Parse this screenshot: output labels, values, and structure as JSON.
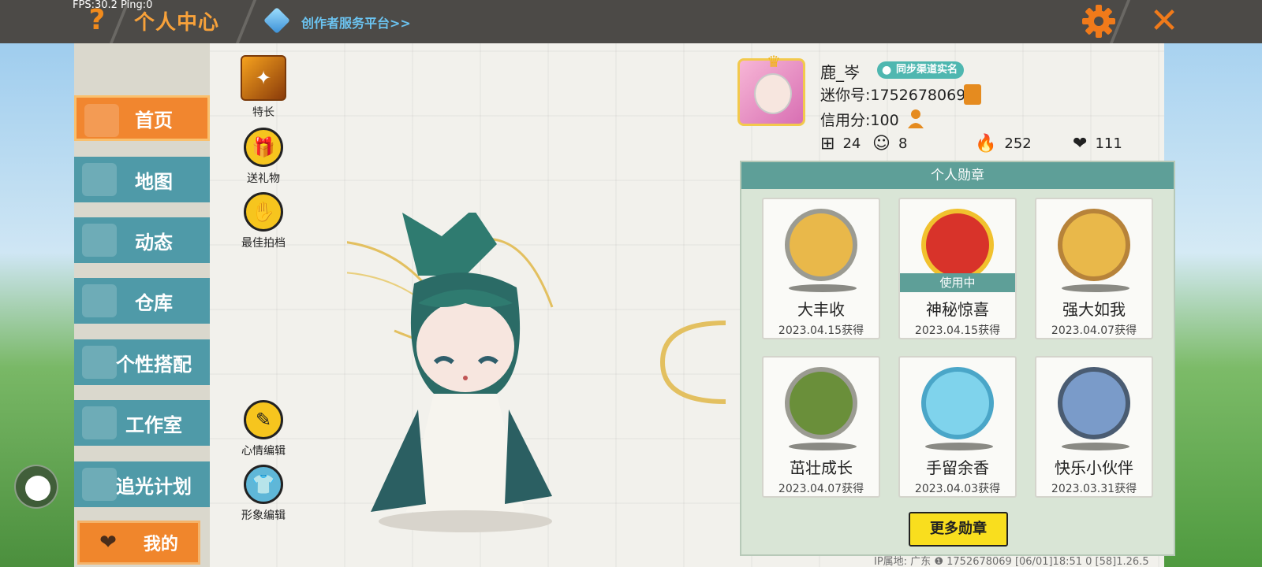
{
  "overlay": {
    "fps": "FPS:30.2",
    "ping": "Ping:0"
  },
  "topbar": {
    "help_icon": "question-icon",
    "title": "个人中心",
    "creator_link": "创作者服务平台>>",
    "settings_icon": "gear-icon",
    "close_icon": "close-icon"
  },
  "sidebar": {
    "items": [
      {
        "label": "首页",
        "active": true
      },
      {
        "label": "地图"
      },
      {
        "label": "动态"
      },
      {
        "label": "仓库"
      },
      {
        "label": "个性搭配"
      },
      {
        "label": "工作室"
      },
      {
        "label": "追光计划"
      }
    ],
    "mine": "我的"
  },
  "tools": {
    "skill": "特长",
    "gift": "送礼物",
    "partner": "最佳拍档",
    "mood": "心情编辑",
    "look": "形象编辑"
  },
  "profile": {
    "name": "鹿_岑",
    "verify": "同步渠道实名",
    "mini_id": "迷你号:1752678069",
    "credit": "信用分:100",
    "stats": {
      "add": "24",
      "fans": "8",
      "hot": "252",
      "likes": "111"
    }
  },
  "badges": {
    "title": "个人勋章",
    "in_use_label": "使用中",
    "items": [
      {
        "name": "大丰收",
        "date": "2023.04.15获得",
        "in_use": false
      },
      {
        "name": "神秘惊喜",
        "date": "2023.04.15获得",
        "in_use": true
      },
      {
        "name": "强大如我",
        "date": "2023.04.07获得",
        "in_use": false
      },
      {
        "name": "茁壮成长",
        "date": "2023.04.07获得",
        "in_use": false
      },
      {
        "name": "手留余香",
        "date": "2023.04.03获得",
        "in_use": false
      },
      {
        "name": "快乐小伙伴",
        "date": "2023.03.31获得",
        "in_use": false
      }
    ],
    "more": "更多勋章"
  },
  "footer": {
    "ip_info": "IP属地: 广东 ❶   1752678069  [06/01]18:51 0  [58]1.26.5"
  }
}
